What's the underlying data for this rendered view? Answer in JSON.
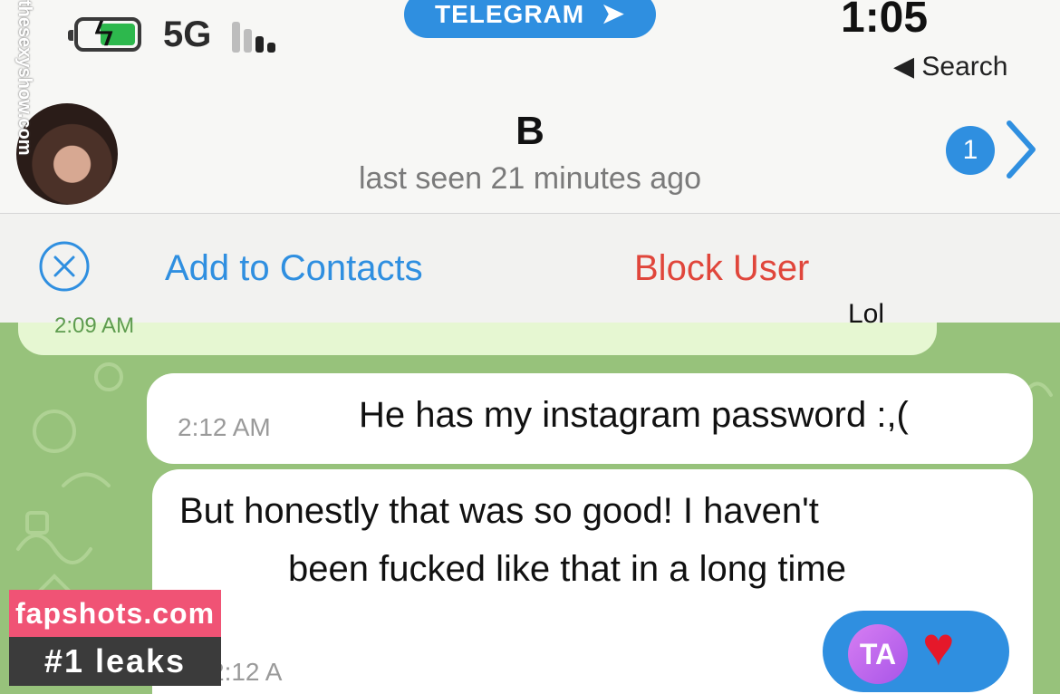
{
  "status_bar": {
    "network": "5G",
    "time": "1:05",
    "back_label": "◀ Search",
    "app_pill": "TELEGRAM"
  },
  "header": {
    "contact_name": "B",
    "last_seen": "last seen 21 minutes ago",
    "unread_count": "1",
    "side_watermark": "thesexyshow.com"
  },
  "actions": {
    "add_contacts": "Add to Contacts",
    "block_user": "Block User"
  },
  "messages": [
    {
      "text": "He has my instagram password :,(",
      "time": "2:12 AM"
    },
    {
      "line1": "But honestly that was so good! I haven't",
      "line2": "been fucked like that in a long time",
      "time": "2:12 A"
    }
  ],
  "previous_message": {
    "text": "Lol",
    "time": "2:09 AM"
  },
  "reaction": {
    "avatar_initials": "TA",
    "emoji": "♥"
  },
  "watermark": {
    "site": "fapshots.com",
    "tagline": "#1 leaks"
  },
  "colors": {
    "accent": "#2f8fe0",
    "danger": "#e0463b",
    "chat_bg": "#97c27b"
  }
}
